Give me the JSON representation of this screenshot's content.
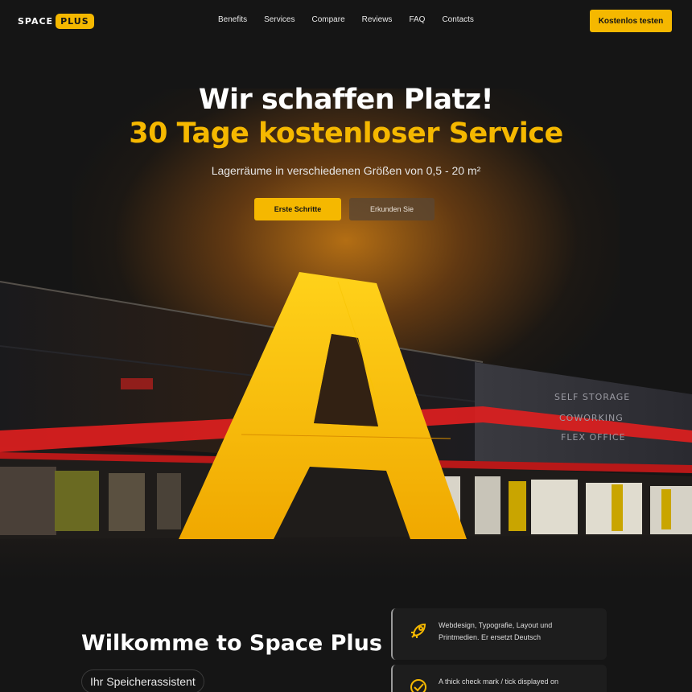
{
  "brand": {
    "logo_word": "SPACE",
    "logo_badge": "PLUS"
  },
  "nav": {
    "items": [
      "Benefits",
      "Services",
      "Compare",
      "Reviews",
      "FAQ",
      "Contacts"
    ],
    "cta": "Kostenlos testen"
  },
  "hero": {
    "title": "Wir schaffen Platz!",
    "subtitle": "30 Tage kostenloser Service",
    "text": "Lagerräume in verschiedenen Größen von 0,5 - 20 m²",
    "primary_button": "Erste Schritte",
    "secondary_button": "Erkunden Sie"
  },
  "building": {
    "signs": [
      "SELF STORAGE",
      "COWORKING",
      "FLEX OFFICE"
    ]
  },
  "about": {
    "heading": "Wilkomme to Space Plus",
    "pill": "Ihr Speicherassistent"
  },
  "features": [
    {
      "icon": "rocket-icon",
      "text": "Webdesign, Typografie, Layout und Printmedien. Er ersetzt Deutsch"
    },
    {
      "icon": "check-mark-icon",
      "text": "A thick check mark / tick displayed on"
    }
  ],
  "colors": {
    "accent": "#f5b800",
    "background": "#151515",
    "stripe": "#e11f1f"
  }
}
